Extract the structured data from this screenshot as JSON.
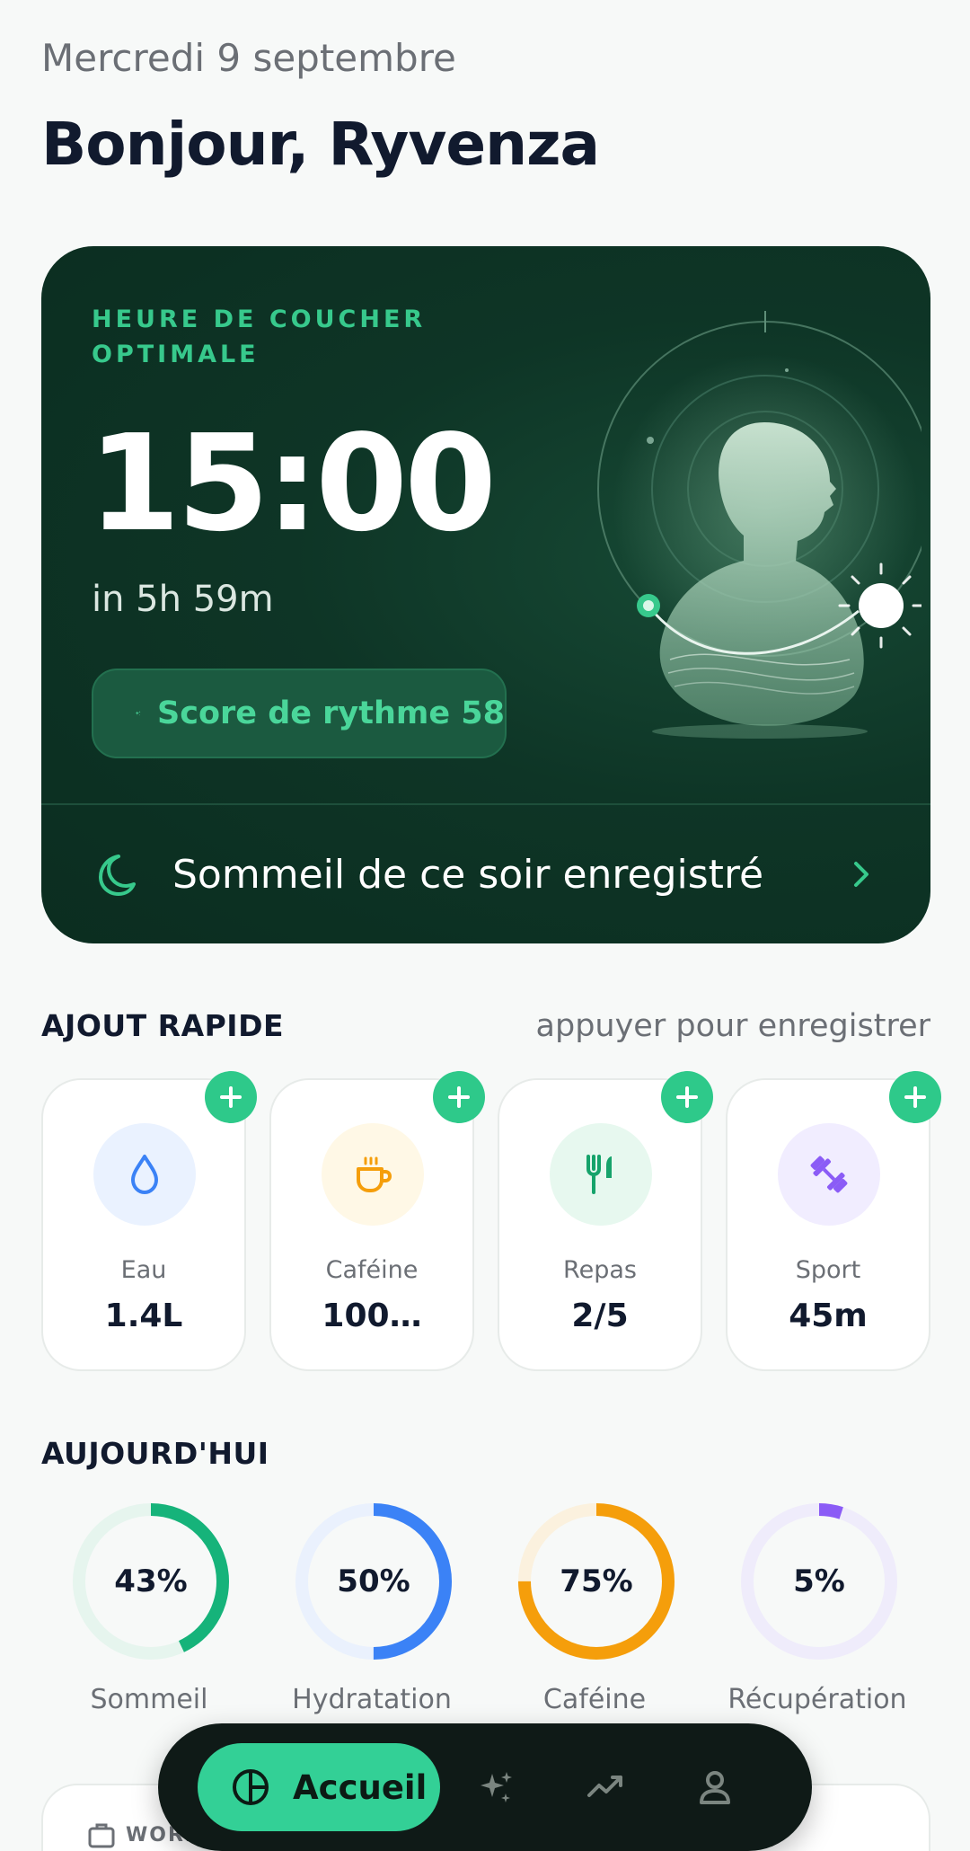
{
  "header": {
    "date": "Mercredi 9 septembre",
    "greeting": "Bonjour, Ryvenza"
  },
  "hero": {
    "label": "HEURE DE COUCHER OPTIMALE",
    "time": "15:00",
    "countdown": "in 5h 59m",
    "score_label": "Score de rythme 58",
    "footer_text": "Sommeil de ce soir enregistré",
    "colors": {
      "background": "#0e3526",
      "accent": "#37c98c"
    }
  },
  "quick_add": {
    "title": "AJOUT RAPIDE",
    "hint": "appuyer pour enregistrer",
    "items": [
      {
        "label": "Eau",
        "value": "1.4L",
        "icon": "water-drop-icon",
        "icon_bg": "#eaf2ff",
        "icon_color": "#3b82f6"
      },
      {
        "label": "Caféine",
        "value": "100…",
        "icon": "coffee-cup-icon",
        "icon_bg": "#fff8e6",
        "icon_color": "#f59e0b"
      },
      {
        "label": "Repas",
        "value": "2/5",
        "icon": "fork-knife-icon",
        "icon_bg": "#e7f8ef",
        "icon_color": "#16a36b"
      },
      {
        "label": "Sport",
        "value": "45m",
        "icon": "dumbbell-icon",
        "icon_bg": "#f1edff",
        "icon_color": "#8b5cf6"
      }
    ]
  },
  "today": {
    "title": "AUJOURD'HUI",
    "rings": [
      {
        "label": "Sommeil",
        "percent": 43,
        "percent_label": "43%",
        "color": "#16b37a",
        "track": "#e6f5ee"
      },
      {
        "label": "Hydratation",
        "percent": 50,
        "percent_label": "50%",
        "color": "#3b82f6",
        "track": "#eaf1fd"
      },
      {
        "label": "Caféine",
        "percent": 75,
        "percent_label": "75%",
        "color": "#f59e0b",
        "track": "#fbf1de"
      },
      {
        "label": "Récupération",
        "percent": 5,
        "percent_label": "5%",
        "color": "#8b5cf6",
        "track": "#efecfb"
      }
    ]
  },
  "bottom": {
    "card_label": "WORK"
  },
  "nav": {
    "home_label": "Accueil",
    "items": [
      "sparkles-icon",
      "trend-icon",
      "profile-icon"
    ]
  }
}
